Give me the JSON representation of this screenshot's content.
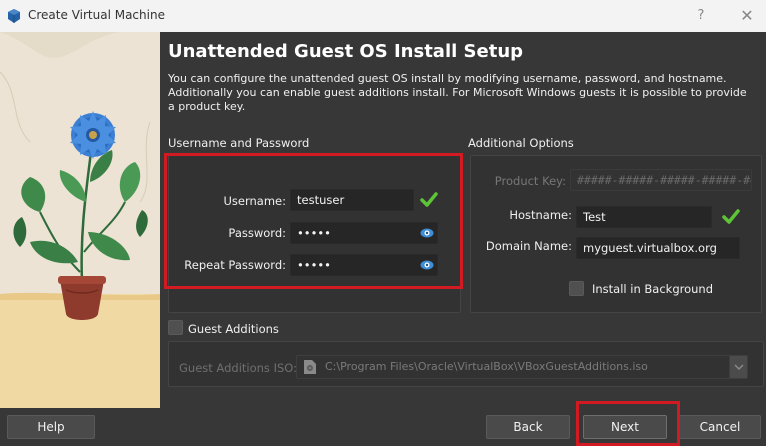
{
  "window": {
    "title": "Create Virtual Machine",
    "help_glyph": "?",
    "close_glyph": "✕"
  },
  "page": {
    "title": "Unattended Guest OS Install Setup",
    "description": "You can configure the unattended guest OS install by modifying username, password, and hostname. Additionally you can enable guest additions install. For Microsoft Windows guests it is possible to provide a product key."
  },
  "credentials": {
    "group_label": "Username and Password",
    "username_label": "Username:",
    "username_value": "testuser",
    "password_label": "Password:",
    "password_value": "•••••",
    "repeat_label": "Repeat Password:",
    "repeat_value": "•••••"
  },
  "options": {
    "group_label": "Additional Options",
    "product_key_label": "Product Key:",
    "product_key_placeholder": "#####-#####-#####-#####-#####",
    "hostname_label": "Hostname:",
    "hostname_value": "Test",
    "domain_label": "Domain Name:",
    "domain_value": "myguest.virtualbox.org",
    "install_background_label": "Install in Background"
  },
  "guest_additions": {
    "checkbox_label": "Guest Additions",
    "iso_label": "Guest Additions ISO:",
    "iso_path": "C:\\Program Files\\Oracle\\VirtualBox\\VBoxGuestAdditions.iso"
  },
  "footer": {
    "help": "Help",
    "back": "Back",
    "next": "Next",
    "cancel": "Cancel"
  },
  "colors": {
    "accent_check": "#5ec437",
    "eye_icon": "#3f8fd8",
    "highlight": "#d11a22",
    "vbox_blue": "#2563a8"
  }
}
